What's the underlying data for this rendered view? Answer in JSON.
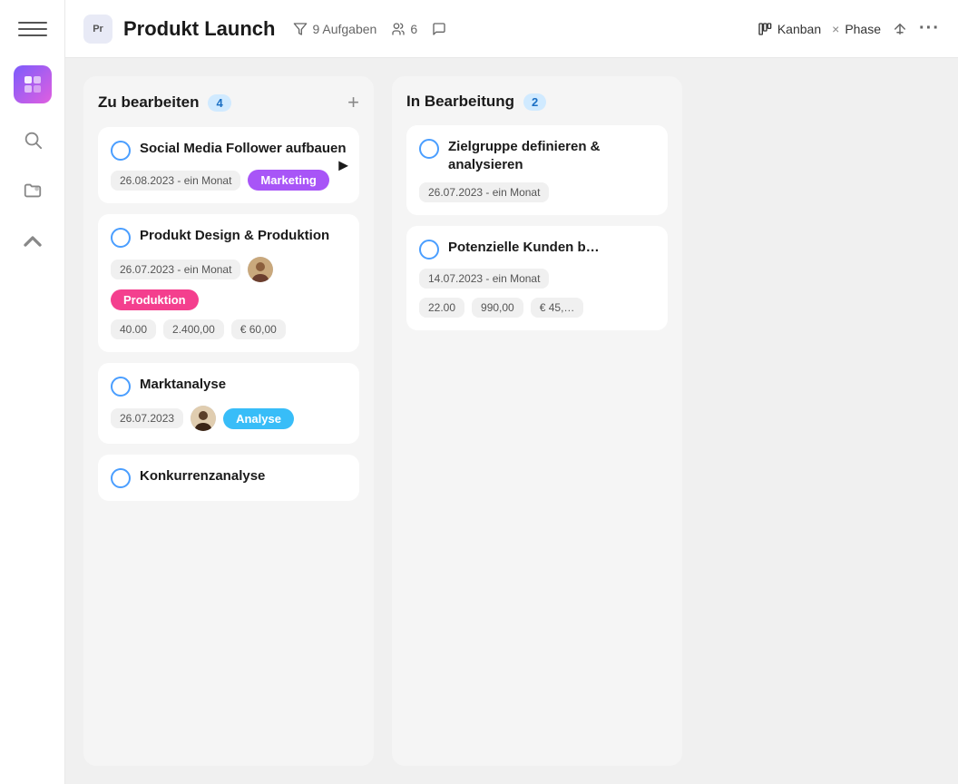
{
  "sidebar": {
    "menu_label": "menu",
    "app_icon_label": "app-icon",
    "search_label": "search",
    "folder_label": "folder",
    "collapse_label": "collapse"
  },
  "header": {
    "project_badge": "Pr",
    "project_title": "Produkt Launch",
    "filter_label": "filter",
    "tasks_label": "9 Aufgaben",
    "members_label": "6",
    "comment_label": "comment",
    "kanban_label": "Kanban",
    "phase_close_label": "×",
    "phase_label": "Phase",
    "sort_label": "sort",
    "more_label": "···"
  },
  "columns": [
    {
      "id": "zu-bearbeiten",
      "title": "Zu bearbeiten",
      "count": "4",
      "cards": [
        {
          "id": "card-1",
          "title": "Social Media Follower aufbauen",
          "date": "26.08.2023 - ein Monat",
          "tag": "Marketing",
          "tag_class": "tag-marketing",
          "has_arrow": true
        },
        {
          "id": "card-2",
          "title": "Produkt Design & Produktion",
          "date": "26.07.2023 - ein Monat",
          "tag": "Produktion",
          "tag_class": "tag-produktion",
          "has_avatar": true,
          "numbers": [
            "40.00",
            "2.400,00",
            "€ 60,00"
          ]
        },
        {
          "id": "card-3",
          "title": "Marktanalyse",
          "date": "26.07.2023",
          "tag": "Analyse",
          "tag_class": "tag-analyse",
          "has_avatar2": true
        },
        {
          "id": "card-4",
          "title": "Konkurrenzanalyse",
          "date": null,
          "tag": null
        }
      ]
    },
    {
      "id": "in-bearbeitung",
      "title": "In Bearbeitung",
      "count": "2",
      "cards": [
        {
          "id": "card-5",
          "title": "Zielgruppe definieren & analysieren",
          "date": "26.07.2023 - ein Monat",
          "tag": null
        },
        {
          "id": "card-6",
          "title": "Potenzielle Kunden b…",
          "date": "14.07.2023 - ein Monat",
          "tag": null,
          "numbers": [
            "22.00",
            "990,00",
            "€ 45,…"
          ]
        }
      ]
    }
  ]
}
